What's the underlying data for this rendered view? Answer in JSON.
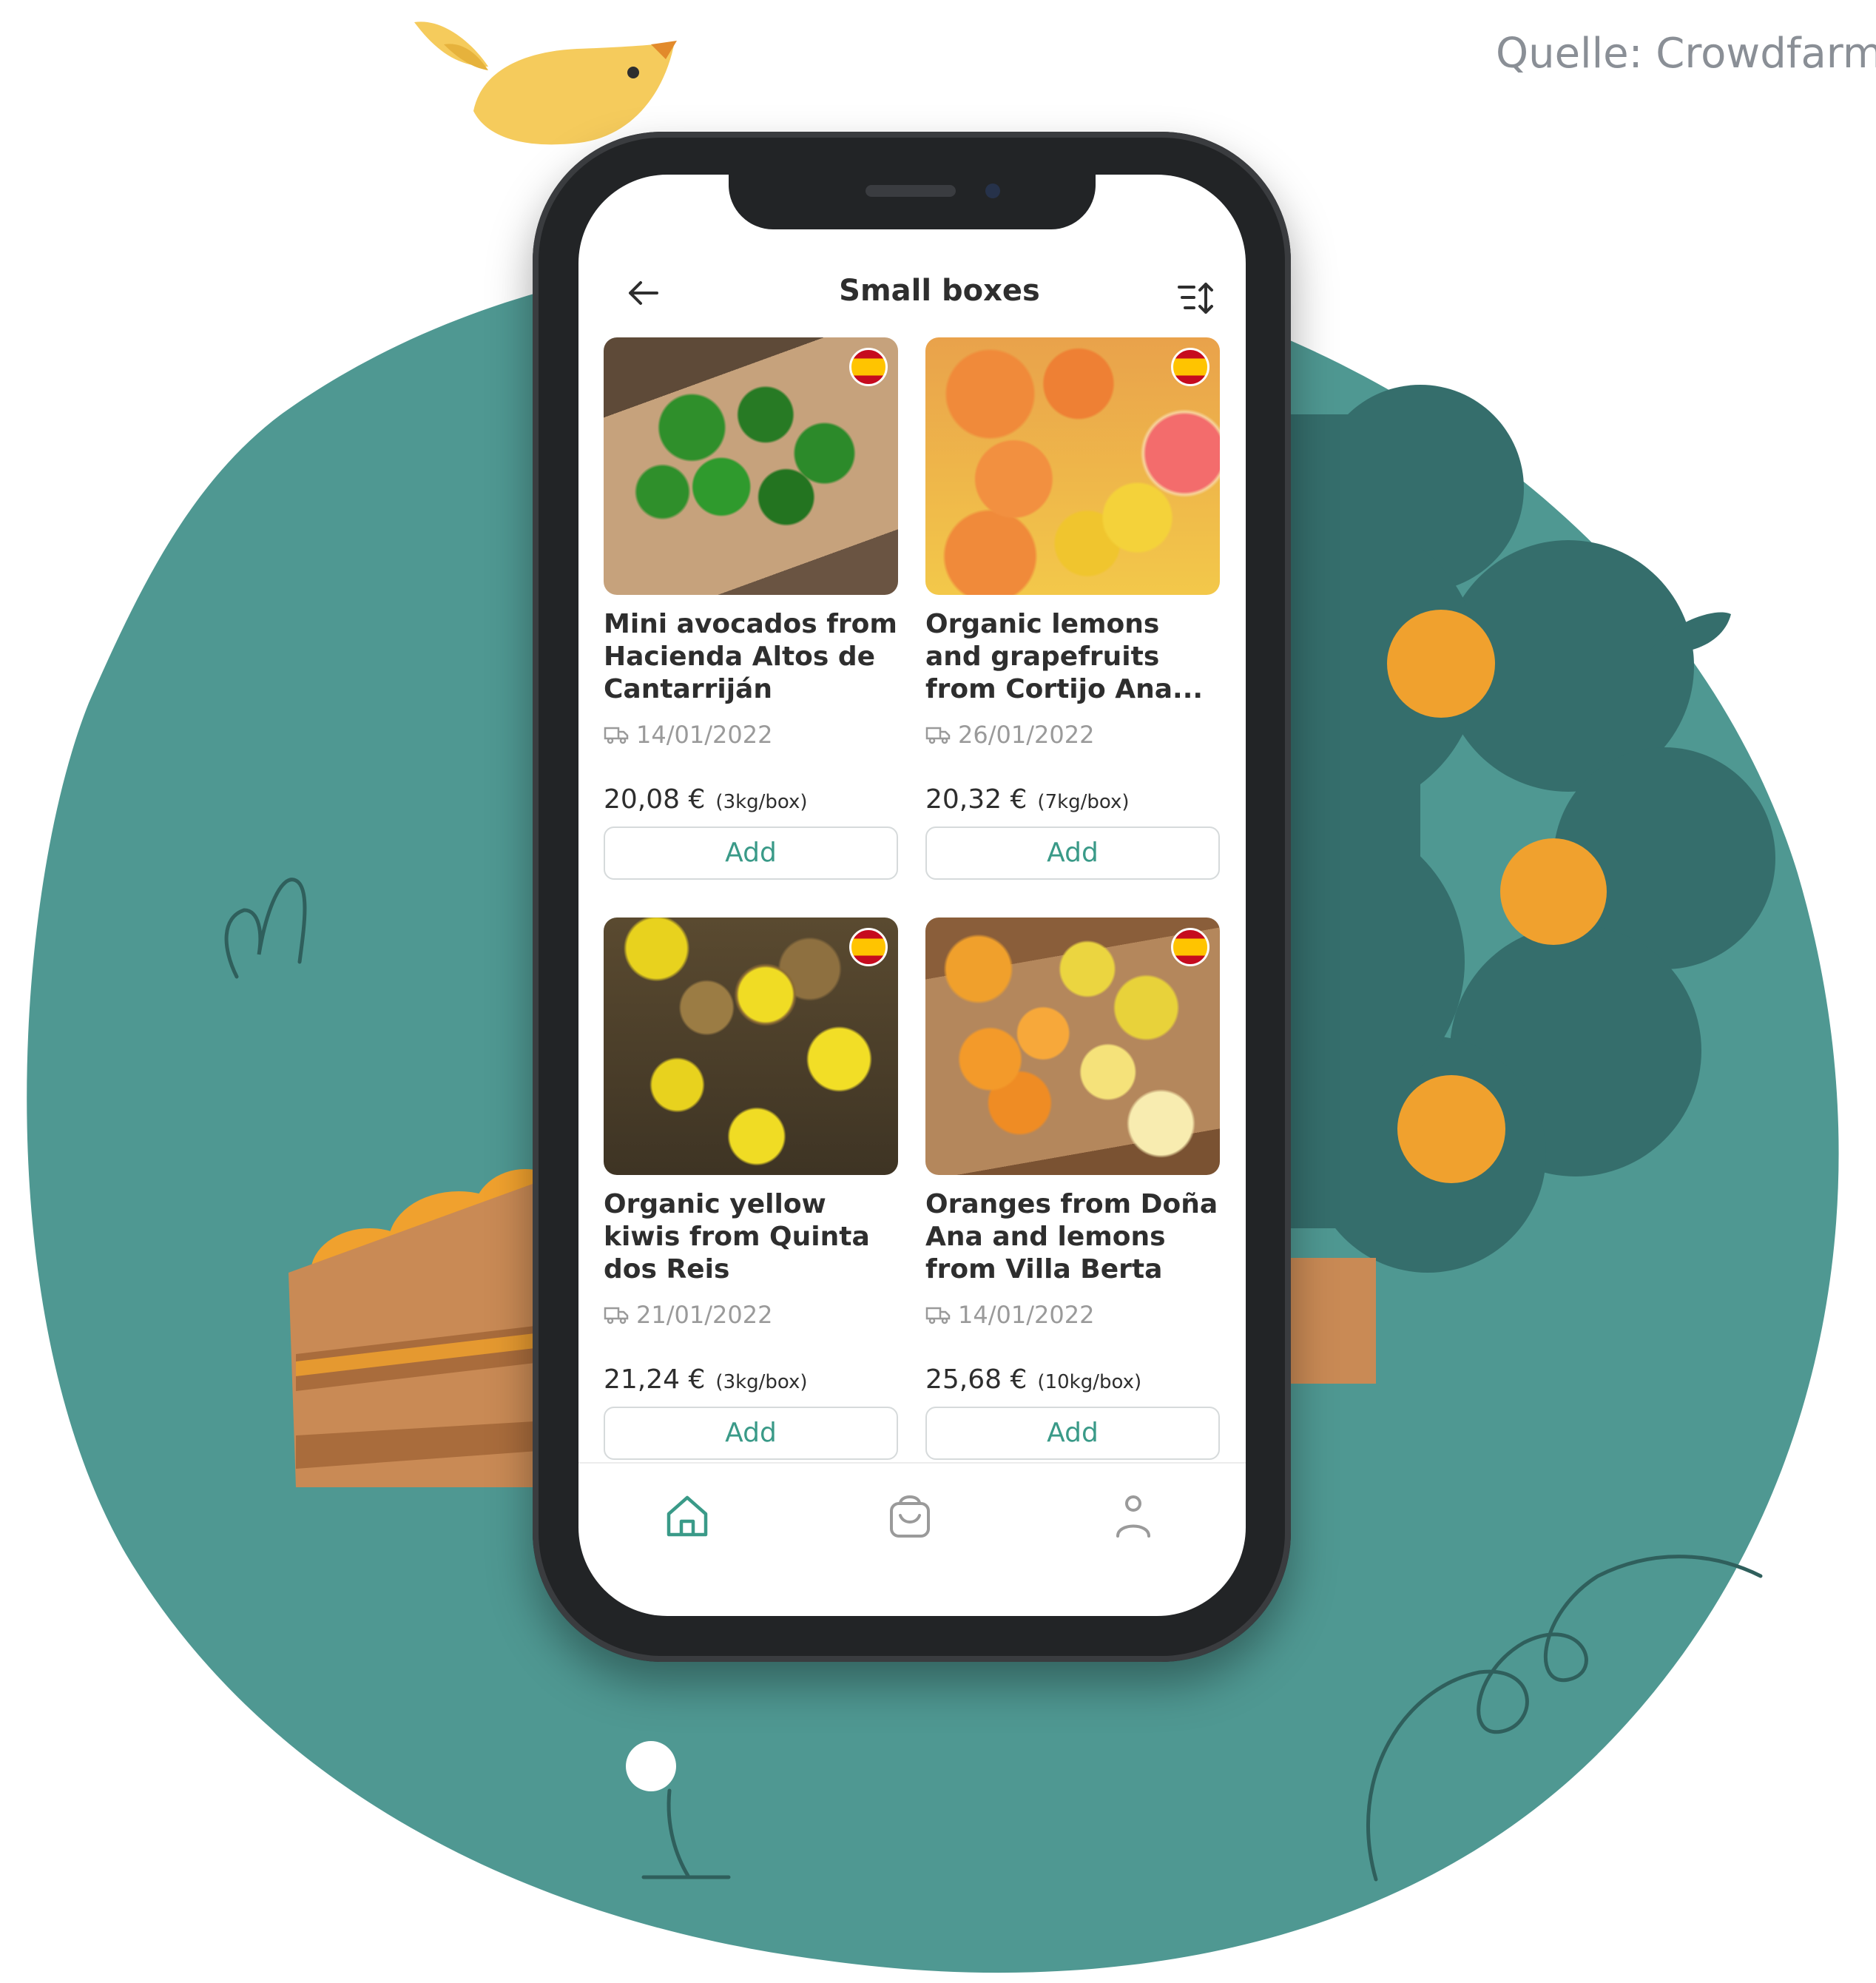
{
  "credit": "Quelle: Crowdfarm",
  "app": {
    "title": "Small boxes",
    "back_icon": "arrow-left-icon",
    "sort_icon": "sort-icon"
  },
  "products": [
    {
      "name": "Mini avocados from Hacienda Altos de Cantarriján",
      "date": "14/01/2022",
      "price": "20,08 €",
      "unit": "(3kg/box)",
      "add": "Add",
      "image": "avocado-box-photo",
      "flag": "spain-flag-icon"
    },
    {
      "name": "Organic lemons and grapefruits from Cortijo Ana...",
      "date": "26/01/2022",
      "price": "20,32 €",
      "unit": "(7kg/box)",
      "add": "Add",
      "image": "lemons-grapefruits-photo",
      "flag": "spain-flag-icon"
    },
    {
      "name": "Organic yellow kiwis from Quinta dos Reis",
      "date": "21/01/2022",
      "price": "21,24 €",
      "unit": "(3kg/box)",
      "add": "Add",
      "image": "yellow-kiwis-photo",
      "flag": "spain-flag-icon"
    },
    {
      "name": "Oranges from Doña Ana and lemons from Villa Berta",
      "date": "14/01/2022",
      "price": "25,68 €",
      "unit": "(10kg/box)",
      "add": "Add",
      "image": "oranges-lemons-photo",
      "flag": "spain-flag-icon"
    }
  ],
  "bottom_nav": {
    "items": [
      "home-icon",
      "basket-icon",
      "user-icon"
    ],
    "active_color": "#3a9a88",
    "inactive_color": "#9a9a9a"
  },
  "colors": {
    "teal_background": "#4f9892",
    "dark_teal_tree": "#356e6c",
    "fruit_orange": "#f0a12e",
    "crate_brown": "#c98a55",
    "accent_green": "#3a9a88"
  }
}
